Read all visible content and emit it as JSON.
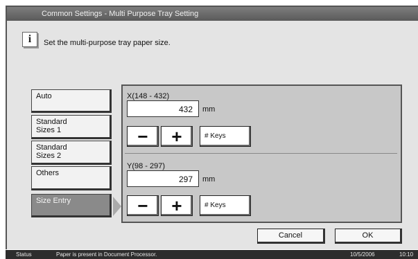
{
  "window": {
    "title": "Common Settings - Multi Purpose Tray Setting"
  },
  "message": {
    "icon": "info-icon",
    "text": "Set the multi-purpose tray paper size."
  },
  "size_buttons": [
    {
      "label": "Auto"
    },
    {
      "label": "Standard\nSizes 1"
    },
    {
      "label": "Standard\nSizes 2"
    },
    {
      "label": "Others"
    },
    {
      "label": "Size Entry",
      "selected": true
    }
  ],
  "x_entry": {
    "label": "X(148 - 432)",
    "value": "432",
    "unit": "mm",
    "keys_label": "# Keys"
  },
  "y_entry": {
    "label": "Y(98 - 297)",
    "value": "297",
    "unit": "mm",
    "keys_label": "# Keys"
  },
  "controls": {
    "minus": "−",
    "plus": "+"
  },
  "footer": {
    "cancel_label": "Cancel",
    "ok_label": "OK"
  },
  "status": {
    "label": "Status",
    "message": "Paper is present in Document Processor.",
    "date": "10/5/2006",
    "time": "10:10"
  },
  "colors": {
    "title_bar": "#6b6b6b",
    "panel": "#c8c8c8",
    "selected_button": "#8a8a8a",
    "status_bar": "#2d2d2d"
  }
}
